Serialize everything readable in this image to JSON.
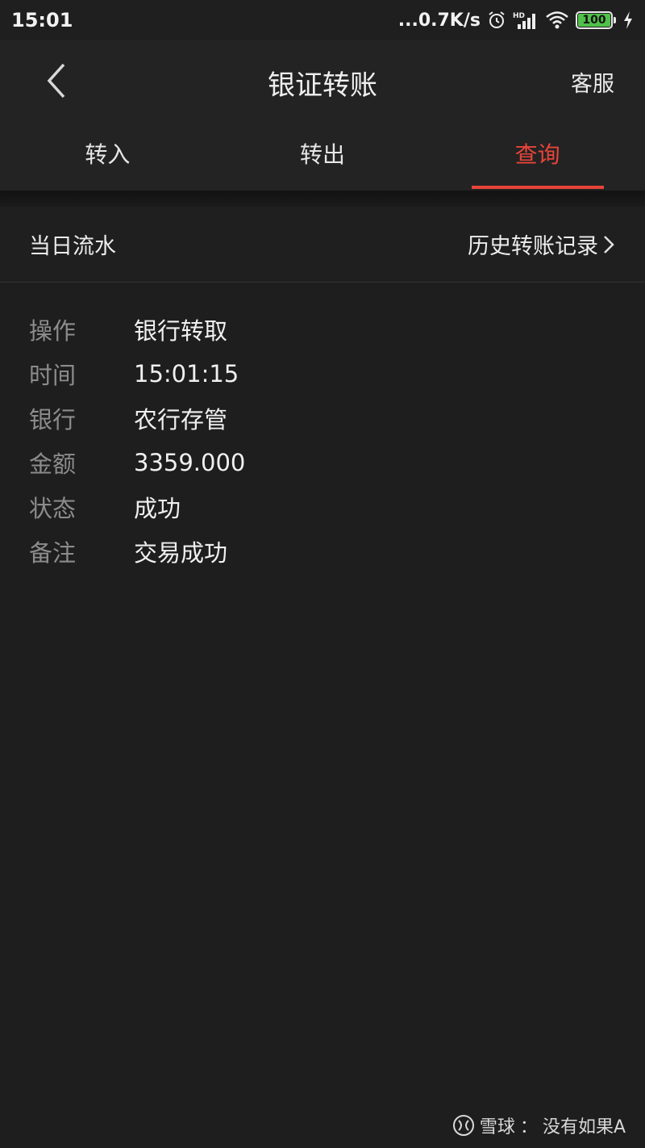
{
  "status_bar": {
    "time": "15:01",
    "net_speed": "...0.7K/s",
    "hd_label": "HD",
    "battery": "100",
    "icons": [
      "alarm-icon",
      "signal-icon",
      "wifi-icon",
      "battery-icon",
      "charging-icon"
    ]
  },
  "header": {
    "title": "银证转账",
    "service_label": "客服",
    "back_icon": "chevron-left-icon"
  },
  "tabs": [
    {
      "label": "转入",
      "active": false
    },
    {
      "label": "转出",
      "active": false
    },
    {
      "label": "查询",
      "active": true
    }
  ],
  "section": {
    "title": "当日流水",
    "history_link": "历史转账记录",
    "history_icon": "chevron-right-icon"
  },
  "record": [
    {
      "label": "操作",
      "value": "银行转取"
    },
    {
      "label": "时间",
      "value": "15:01:15"
    },
    {
      "label": "银行",
      "value": "农行存管"
    },
    {
      "label": "金额",
      "value": "3359.000"
    },
    {
      "label": "状态",
      "value": "成功"
    },
    {
      "label": "备注",
      "value": "交易成功"
    }
  ],
  "watermark": {
    "brand": "雪球",
    "separator": "：",
    "author": "没有如果A"
  },
  "colors": {
    "background": "#1e1e1e",
    "accent": "#e8443a",
    "label": "#8c8c8c",
    "battery": "#4fc14a"
  }
}
